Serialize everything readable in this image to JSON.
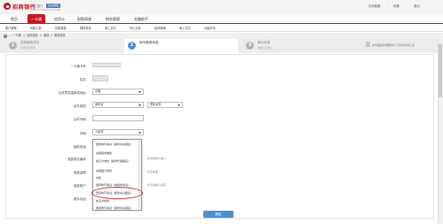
{
  "header": {
    "bank_name": "招商银行",
    "product": "网上银行",
    "badge": "企业网银",
    "subtitle": "CHINA MERCHANTS BANK",
    "links": [
      "在线客服",
      "设置",
      "退出"
    ]
  },
  "nav": {
    "items": [
      "首页",
      "一卡通",
      "信用卡",
      "财智网银",
      "财务管理",
      "金融助手"
    ],
    "active_index": 1
  },
  "subnav": {
    "items": [
      "账户管理",
      "转账汇款",
      "自助缴费",
      "理财投资",
      "网上支付",
      "外汇业务",
      "投资管理",
      "网上支付",
      "功能申请"
    ]
  },
  "breadcrumb": {
    "items": [
      "一卡通",
      "自助缴费",
      "缴费",
      "缴费服务"
    ]
  },
  "steps": [
    {
      "number": "1",
      "title": "选择缴费项目",
      "desc": "选择项目缴费"
    },
    {
      "number": "2",
      "title": "填写缴费信息",
      "desc": ""
    },
    {
      "number": "3",
      "title": "确认信息",
      "desc": "缴费信息确认"
    }
  ],
  "form": {
    "card_label": "一卡通卡号：",
    "name_label": "姓名：",
    "country_label": "证件签发国家或地区：",
    "country_value": "中国",
    "id_type_label": "证件类型：",
    "id_type_value": "身份证",
    "id_subtype_value": "居民证件",
    "id_no_label": "证件号码：",
    "currency_label": "币种：",
    "currency_value": "人民币",
    "purpose_label": "缴款用途：",
    "purpose_value": "国家教育考试（留学考试报名）",
    "field7_label": "缴费项目编号：",
    "field8_label": "缴费金额：",
    "field9_label": "缴费账户：",
    "field10_label": "联系电话：",
    "side_note_1": "仅支持本人账户",
    "side_note_2": "外汇额度",
    "side_note_3": "仅可选择人民币",
    "submit_label": "确定",
    "right_hint": "本页面操作需要用户已完成身份认证"
  },
  "dropdown": {
    "options": [
      "国家教育考试（留学考试报名）",
      "出国留学缴费",
      "新东方学校（留学代理报名）",
      "中国银行学费",
      "学费",
      "国家教育考试（非留学考试）",
      "国家教育考试（留学考试报名）",
      "新东方学校",
      "国家教育考试（留学考试报名）"
    ],
    "highlighted_index": 6
  }
}
